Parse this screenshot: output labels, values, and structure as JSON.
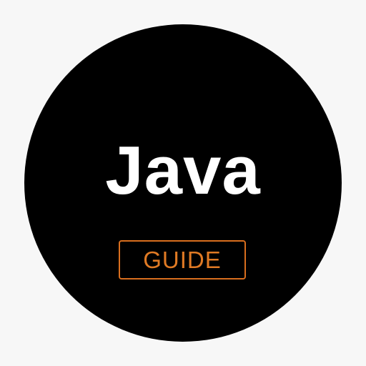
{
  "logo": {
    "title": "Java",
    "badge_label": "GUIDE"
  },
  "colors": {
    "background": "#f7f7f7",
    "circle": "#000000",
    "title_text": "#ffffff",
    "badge_accent": "#e07a24"
  }
}
